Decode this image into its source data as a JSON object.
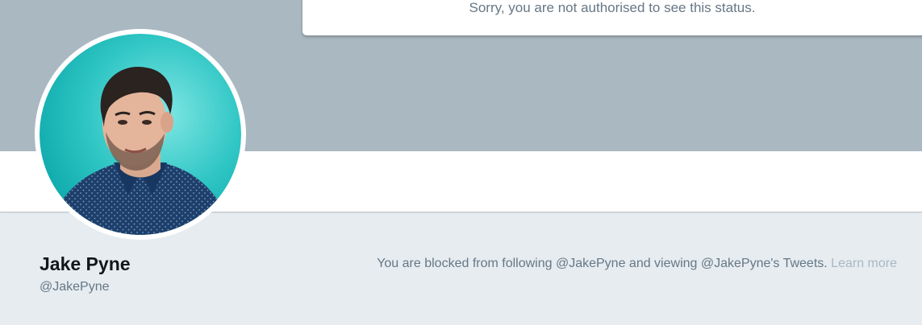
{
  "status_card": {
    "message": "Sorry, you are not authorised to see this status."
  },
  "profile": {
    "display_name": "Jake Pyne",
    "screen_name": "@JakePyne",
    "avatar_alt": "Jake Pyne"
  },
  "blocked_notice": {
    "message": "You are blocked from following @JakePyne and viewing @JakePyne's Tweets.",
    "learn_more_label": "Learn more"
  },
  "colors": {
    "banner": "#aab8c2",
    "page_background": "#e6ecf0",
    "secondary_text": "#657786",
    "link_muted": "#aab8c2"
  }
}
